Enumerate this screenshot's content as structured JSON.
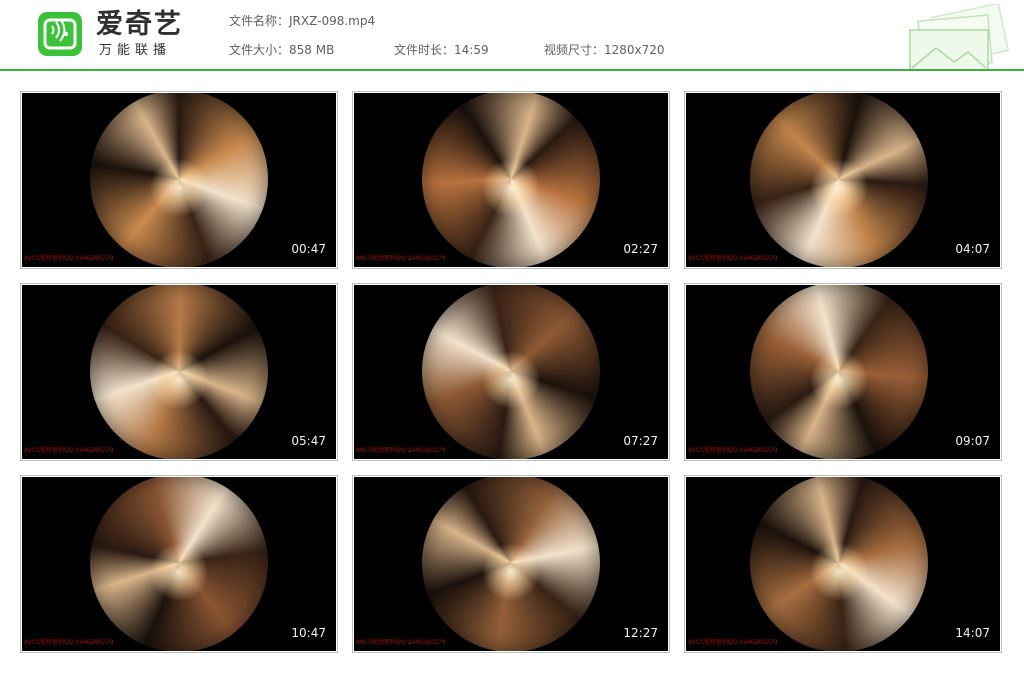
{
  "brand": {
    "name": "爱奇艺",
    "slogan": "万能联播",
    "accent": "#3fae3a",
    "logo_green": "#3cc13b"
  },
  "file": {
    "name_label": "文件名称：",
    "name_value": "JRXZ-098.mp4",
    "size_label": "文件大小：",
    "size_value": "858 MB",
    "duration_label": "文件时长：",
    "duration_value": "14:59",
    "resolution_label": "视频尺寸：",
    "resolution_value": "1280x720"
  },
  "thumbnails": [
    {
      "time": "00:47",
      "watermark": "AVCS视频室制QQ:1946280279",
      "tone": "#c98a4f"
    },
    {
      "time": "02:27",
      "watermark": "AVCS视频室制QQ:1946280279",
      "tone": "#b8723f"
    },
    {
      "time": "04:07",
      "watermark": "AVCS视频室制QQ:1946280279",
      "tone": "#c2854c"
    },
    {
      "time": "05:47",
      "watermark": "AVCS视频室制QQ:1946280279",
      "tone": "#b57a48"
    },
    {
      "time": "07:27",
      "watermark": "AVCS视频室制QQ:1946280279",
      "tone": "#8f5a35"
    },
    {
      "time": "09:07",
      "watermark": "AVCS视频室制QQ:1946280279",
      "tone": "#9a6038"
    },
    {
      "time": "10:47",
      "watermark": "AVCS视频室制QQ:1946280279",
      "tone": "#8a5533"
    },
    {
      "time": "12:27",
      "watermark": "AVCS视频室制QQ:1946280279",
      "tone": "#94603a"
    },
    {
      "time": "14:07",
      "watermark": "AVCS视频室制QQ:1946280279",
      "tone": "#a86e40"
    }
  ]
}
